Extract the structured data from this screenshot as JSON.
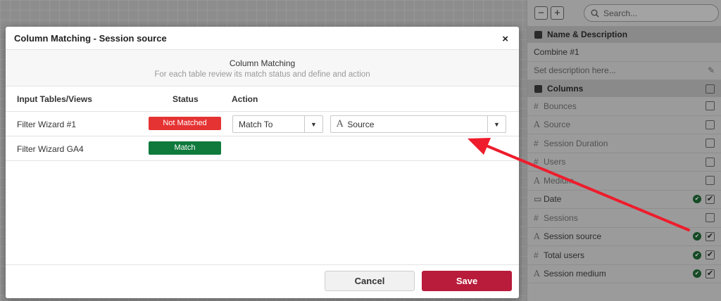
{
  "panel": {
    "zoom_out": "−",
    "zoom_in": "+",
    "search_placeholder": "Search...",
    "sections": {
      "name_desc": "Name & Description",
      "columns": "Columns"
    },
    "name_value": "Combine #1",
    "description_placeholder": "Set description here...",
    "columns": [
      {
        "type": "#",
        "label": "Bounces",
        "checked": false,
        "ok": false
      },
      {
        "type": "A",
        "label": "Source",
        "checked": false,
        "ok": false
      },
      {
        "type": "#",
        "label": "Session Duration",
        "checked": false,
        "ok": false
      },
      {
        "type": "#",
        "label": "Users",
        "checked": false,
        "ok": false
      },
      {
        "type": "A",
        "label": "Medium",
        "checked": false,
        "ok": false
      },
      {
        "type": "date",
        "label": "Date",
        "checked": true,
        "ok": true
      },
      {
        "type": "#",
        "label": "Sessions",
        "checked": false,
        "ok": false
      },
      {
        "type": "A",
        "label": "Session source",
        "checked": true,
        "ok": true
      },
      {
        "type": "#",
        "label": "Total users",
        "checked": true,
        "ok": true
      },
      {
        "type": "A",
        "label": "Session medium",
        "checked": true,
        "ok": true
      }
    ]
  },
  "modal": {
    "title": "Column Matching - Session source",
    "close": "×",
    "info_title": "Column Matching",
    "info_sub": "For each table review its match status and define and action",
    "headers": {
      "tables": "Input Tables/Views",
      "status": "Status",
      "action": "Action"
    },
    "rows": [
      {
        "name": "Filter Wizard #1",
        "status": "Not Matched",
        "action": "Match To",
        "target": "Source"
      },
      {
        "name": "Filter Wizard GA4",
        "status": "Match"
      }
    ],
    "cancel": "Cancel",
    "save": "Save"
  },
  "colors": {
    "not_matched": "#e53333",
    "matched": "#0f7a3c",
    "save": "#b91b3b",
    "arrow": "#ee1c2c"
  }
}
